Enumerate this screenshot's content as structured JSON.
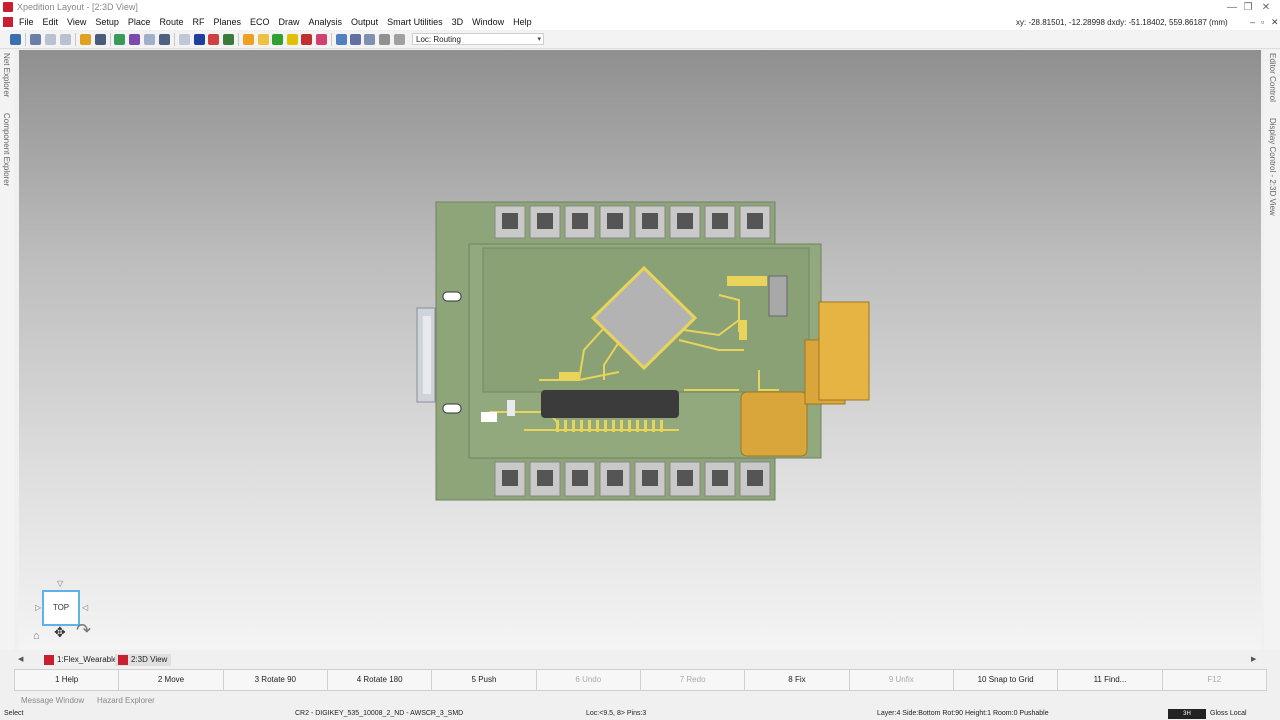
{
  "window": {
    "title": "Xpedition Layout - [2:3D View]",
    "minimize_glyph": "—",
    "restore_glyph": "❐",
    "close_glyph": "✕"
  },
  "menu": {
    "items": [
      "File",
      "Edit",
      "View",
      "Setup",
      "Place",
      "Route",
      "RF",
      "Planes",
      "ECO",
      "Draw",
      "Analysis",
      "Output",
      "Smart Utilities",
      "3D",
      "Window",
      "Help"
    ],
    "coords": "xy: -28.81501, -12.28998 dxdy: -51.18402, 559.86187 (mm)",
    "mdi_min": "–",
    "mdi_restore": "▫",
    "mdi_close": "✕"
  },
  "toolbar": {
    "loc_value": "Loc: Routing",
    "loc_arrow": "▾"
  },
  "left_panels": [
    "Net Explorer",
    "Component Explorer"
  ],
  "right_panels": [
    "Editor Control",
    "Display Control - 2:3D View"
  ],
  "navcube": {
    "face": "TOP",
    "up_arrow": "▽",
    "left_arrow": "▷",
    "right_arrow": "◁",
    "home_glyph": "⌂",
    "pan_glyph": "✥",
    "orbit_glyph": "↷"
  },
  "doc_tabs": {
    "scroll_left": "◀",
    "scroll_right": "▶",
    "tabs": [
      "1:Flex_Wearable",
      "2:3D View"
    ]
  },
  "fkeys": [
    {
      "label": "1 Help",
      "enabled": true
    },
    {
      "label": "2 Move",
      "enabled": true
    },
    {
      "label": "3 Rotate 90",
      "enabled": true
    },
    {
      "label": "4 Rotate 180",
      "enabled": true
    },
    {
      "label": "5 Push",
      "enabled": true
    },
    {
      "label": "6 Undo",
      "enabled": false
    },
    {
      "label": "7 Redo",
      "enabled": false
    },
    {
      "label": "8 Fix",
      "enabled": true
    },
    {
      "label": "9 Unfix",
      "enabled": false
    },
    {
      "label": "10 Snap to Grid",
      "enabled": true
    },
    {
      "label": "11 Find...",
      "enabled": true
    },
    {
      "label": "F12",
      "enabled": false
    }
  ],
  "bottom_tabs": [
    "Message Window",
    "Hazard Explorer"
  ],
  "status": {
    "mode": "Select",
    "part": "CR2 - DIGIKEY_535_10008_2_ND - AWSCR_3_SMD",
    "loc": "Loc:<9.5, 8> Pins:3",
    "layer": "Layer:4 Side:Bottom Rot:90 Height:1 Room:0  Pushable",
    "badge": "3H",
    "gloss": "Gloss Local"
  }
}
